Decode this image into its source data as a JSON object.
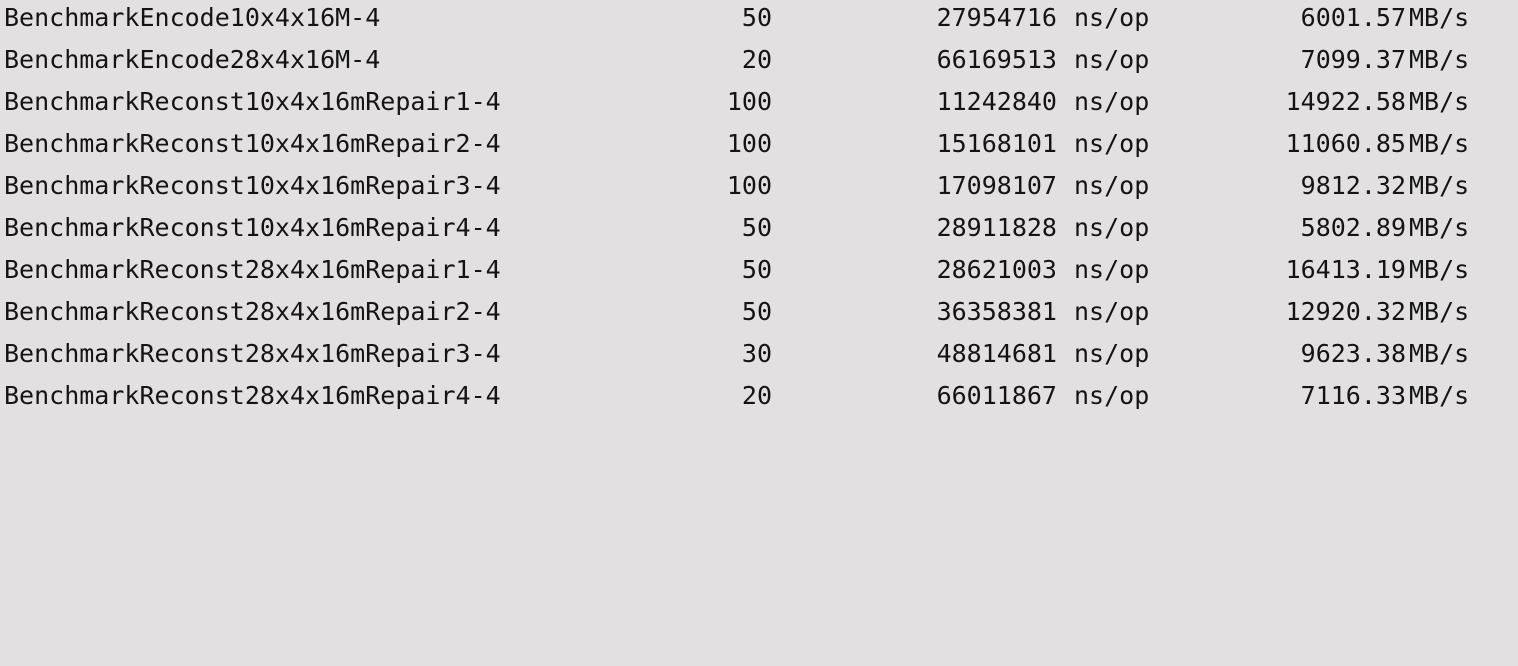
{
  "output": {
    "rows": [
      {
        "name": "BenchmarkEncode10x4x16M-4",
        "iterations": "50",
        "ns_per_op": "27954716",
        "ns_unit": "ns/op",
        "throughput": "6001.57",
        "throughput_unit": "MB/s"
      },
      {
        "name": "BenchmarkEncode28x4x16M-4",
        "iterations": "20",
        "ns_per_op": "66169513",
        "ns_unit": "ns/op",
        "throughput": "7099.37",
        "throughput_unit": "MB/s"
      },
      {
        "name": "BenchmarkReconst10x4x16mRepair1-4",
        "iterations": "100",
        "ns_per_op": "11242840",
        "ns_unit": "ns/op",
        "throughput": "14922.58",
        "throughput_unit": "MB/s"
      },
      {
        "name": "BenchmarkReconst10x4x16mRepair2-4",
        "iterations": "100",
        "ns_per_op": "15168101",
        "ns_unit": "ns/op",
        "throughput": "11060.85",
        "throughput_unit": "MB/s"
      },
      {
        "name": "BenchmarkReconst10x4x16mRepair3-4",
        "iterations": "100",
        "ns_per_op": "17098107",
        "ns_unit": "ns/op",
        "throughput": "9812.32",
        "throughput_unit": "MB/s"
      },
      {
        "name": "BenchmarkReconst10x4x16mRepair4-4",
        "iterations": "50",
        "ns_per_op": "28911828",
        "ns_unit": "ns/op",
        "throughput": "5802.89",
        "throughput_unit": "MB/s"
      },
      {
        "name": "BenchmarkReconst28x4x16mRepair1-4",
        "iterations": "50",
        "ns_per_op": "28621003",
        "ns_unit": "ns/op",
        "throughput": "16413.19",
        "throughput_unit": "MB/s"
      },
      {
        "name": "BenchmarkReconst28x4x16mRepair2-4",
        "iterations": "50",
        "ns_per_op": "36358381",
        "ns_unit": "ns/op",
        "throughput": "12920.32",
        "throughput_unit": "MB/s"
      },
      {
        "name": "BenchmarkReconst28x4x16mRepair3-4",
        "iterations": "30",
        "ns_per_op": "48814681",
        "ns_unit": "ns/op",
        "throughput": "9623.38",
        "throughput_unit": "MB/s"
      },
      {
        "name": "BenchmarkReconst28x4x16mRepair4-4",
        "iterations": "20",
        "ns_per_op": "66011867",
        "ns_unit": "ns/op",
        "throughput": "7116.33",
        "throughput_unit": "MB/s"
      }
    ]
  }
}
